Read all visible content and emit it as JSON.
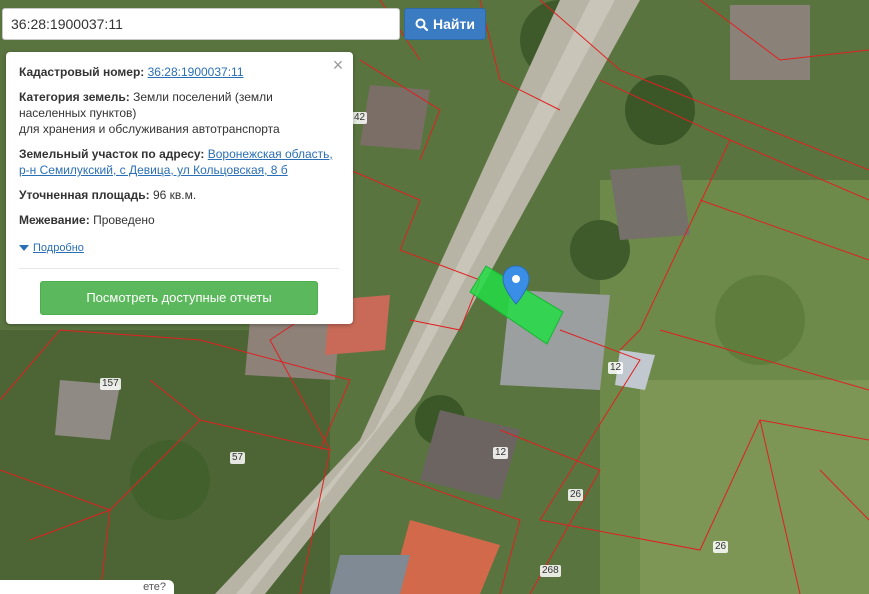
{
  "search": {
    "value": "36:28:1900037:11",
    "button_label": "Найти"
  },
  "popup": {
    "cadastral_label": "Кадастровый номер:",
    "cadastral_value": "36:28:1900037:11",
    "category_label": "Категория земель:",
    "category_value": "Земли поселений (земли населенных пунктов)",
    "category_use": "для хранения и обслуживания автотранспорта",
    "address_label": "Земельный участок по адресу:",
    "address_value": "Воронежская область, р-н Семилукский, с Девица, ул Кольцовская, 8 б",
    "area_label": "Уточненная площадь:",
    "area_value": "96 кв.м.",
    "survey_label": "Межевание:",
    "survey_value": "Проведено",
    "details_label": "Подробно",
    "reports_button": "Посмотреть доступные отчеты"
  },
  "map": {
    "parcel_labels": [
      "42",
      "157",
      "57",
      "12",
      "12",
      "26",
      "26",
      "268"
    ],
    "highlight_color": "#22dd44",
    "marker_color": "#3a8ee6"
  },
  "bottom_strip_text": "ете?"
}
